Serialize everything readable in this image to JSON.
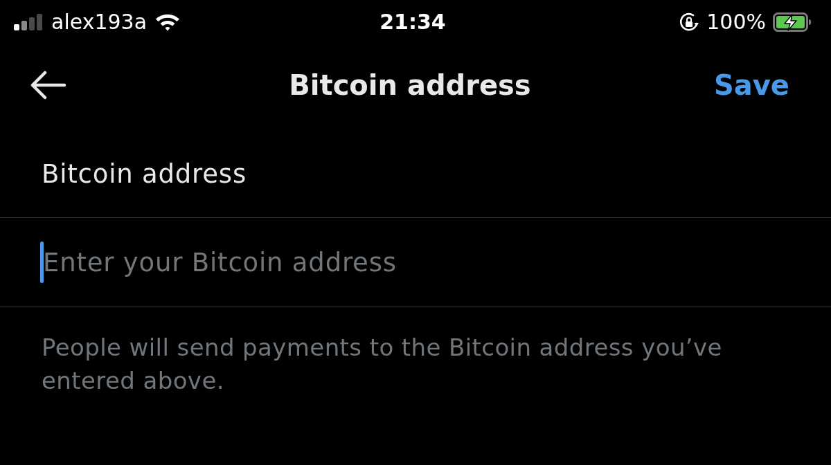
{
  "status_bar": {
    "carrier": "alex193a",
    "time": "21:34",
    "battery": "100%"
  },
  "nav": {
    "title": "Bitcoin address",
    "action": "Save"
  },
  "field": {
    "label": "Bitcoin address",
    "placeholder": "Enter your Bitcoin address",
    "focused": true
  },
  "helper": "People will send payments to the Bitcoin address you’ve entered above."
}
